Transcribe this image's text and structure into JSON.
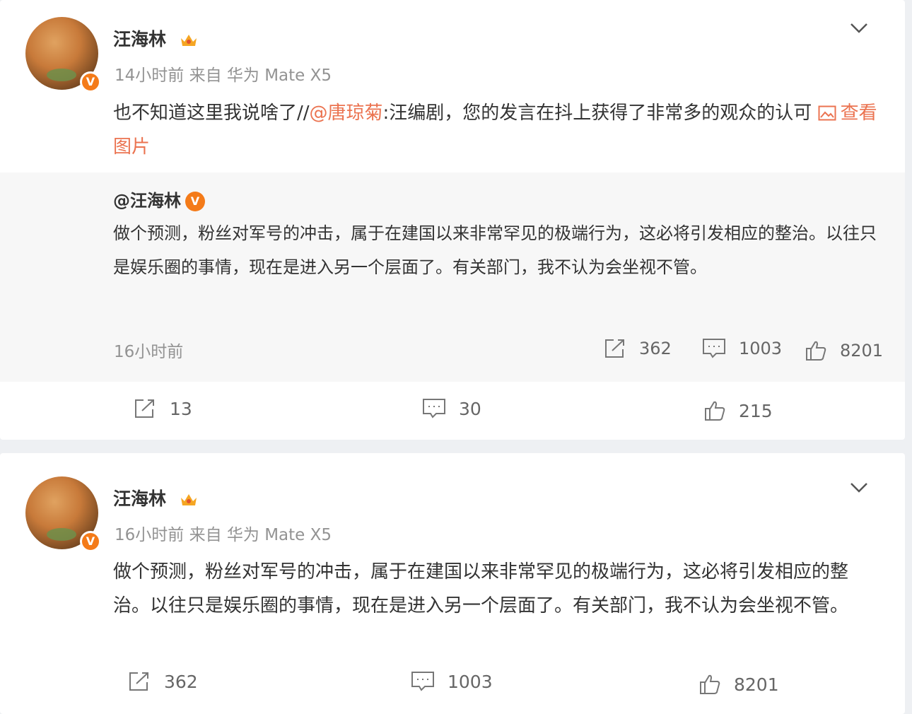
{
  "posts": [
    {
      "username": "汪海林",
      "meta": "14小时前 来自 华为 Mate X5",
      "text_prefix": "也不知道这里我说啥了//",
      "mention": "@唐琼菊",
      "text_suffix": ":汪编剧，您的发言在抖上获得了非常多的观众的认可 ",
      "image_link": "查看图片",
      "repost": {
        "username": "@汪海林",
        "text": "做个预测，粉丝对军号的冲击，属于在建国以来非常罕见的极端行为，这必将引发相应的整治。以往只是娱乐圈的事情，现在是进入另一个层面了。有关部门，我不认为会坐视不管。",
        "time": "16小时前",
        "reposts": "362",
        "comments": "1003",
        "likes": "8201"
      },
      "reposts": "13",
      "comments": "30",
      "likes": "215"
    },
    {
      "username": "汪海林",
      "meta": "16小时前 来自 华为 Mate X5",
      "text": "做个预测，粉丝对军号的冲击，属于在建国以来非常罕见的极端行为，这必将引发相应的整治。以往只是娱乐圈的事情，现在是进入另一个层面了。有关部门，我不认为会坐视不管。",
      "reposts": "362",
      "comments": "1003",
      "likes": "8201"
    }
  ],
  "verified_mark": "V",
  "colors": {
    "accent": "#eb7350",
    "verified": "#f47b19",
    "muted": "#939393",
    "repost_bg": "#f7f7f7"
  },
  "icons": [
    "chevron-down-icon",
    "crown-icon",
    "image-icon",
    "share-icon",
    "comment-icon",
    "like-icon"
  ]
}
